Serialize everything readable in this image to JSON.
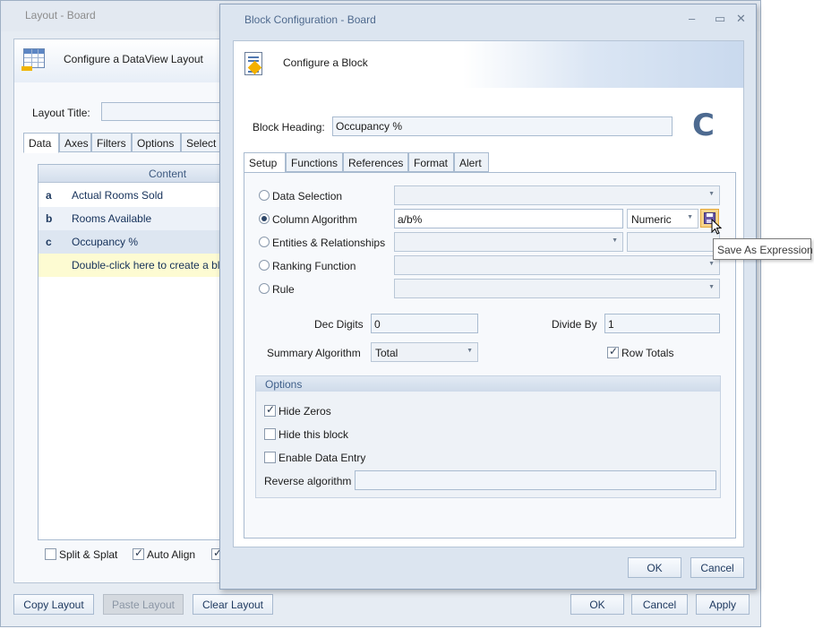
{
  "back_window": {
    "title": "Layout - Board",
    "header_title": "Configure a DataView Layout",
    "layout_title_label": "Layout Title:",
    "layout_title_value": "",
    "tabs": [
      "Data",
      "Axes",
      "Filters",
      "Options",
      "Select"
    ],
    "list_header": "Content",
    "rows": [
      {
        "key": "a",
        "label": "Actual Rooms Sold"
      },
      {
        "key": "b",
        "label": "Rooms Available"
      },
      {
        "key": "c",
        "label": "Occupancy %"
      },
      {
        "key": "",
        "label": "Double-click here to create a bl"
      }
    ],
    "checkboxes": [
      {
        "label": "Split & Splat",
        "checked": false
      },
      {
        "label": "Auto Align",
        "checked": true
      }
    ],
    "buttons": {
      "copy": "Copy Layout",
      "paste": "Paste Layout",
      "clear": "Clear Layout",
      "ok": "OK",
      "cancel": "Cancel",
      "apply": "Apply"
    }
  },
  "front_window": {
    "title": "Block Configuration - Board",
    "header_title": "Configure a Block",
    "block_heading_label": "Block Heading:",
    "block_heading_value": "Occupancy %",
    "big_letter": "C",
    "tabs": [
      "Setup",
      "Functions",
      "References",
      "Format",
      "Alert"
    ],
    "radios": [
      {
        "label": "Data Selection",
        "selected": false
      },
      {
        "label": "Column Algorithm",
        "selected": true
      },
      {
        "label": "Entities & Relationships",
        "selected": false
      },
      {
        "label": "Ranking Function",
        "selected": false
      },
      {
        "label": "Rule",
        "selected": false
      }
    ],
    "algorithm_value": "a/b%",
    "algorithm_type": "Numeric",
    "tooltip": "Save As Expression",
    "dec_digits_label": "Dec Digits",
    "dec_digits_value": "0",
    "divide_by_label": "Divide By",
    "divide_by_value": "1",
    "summary_algorithm_label": "Summary Algorithm",
    "summary_algorithm_value": "Total",
    "row_totals_label": "Row Totals",
    "row_totals_checked": true,
    "options_group": {
      "title": "Options",
      "hide_zeros_label": "Hide Zeros",
      "hide_zeros_checked": true,
      "hide_block_label": "Hide this block",
      "hide_block_checked": false,
      "data_entry_label": "Enable Data Entry",
      "data_entry_checked": false,
      "reverse_algorithm_label": "Reverse algorithm",
      "reverse_algorithm_value": ""
    },
    "buttons": {
      "ok": "OK",
      "cancel": "Cancel"
    }
  }
}
